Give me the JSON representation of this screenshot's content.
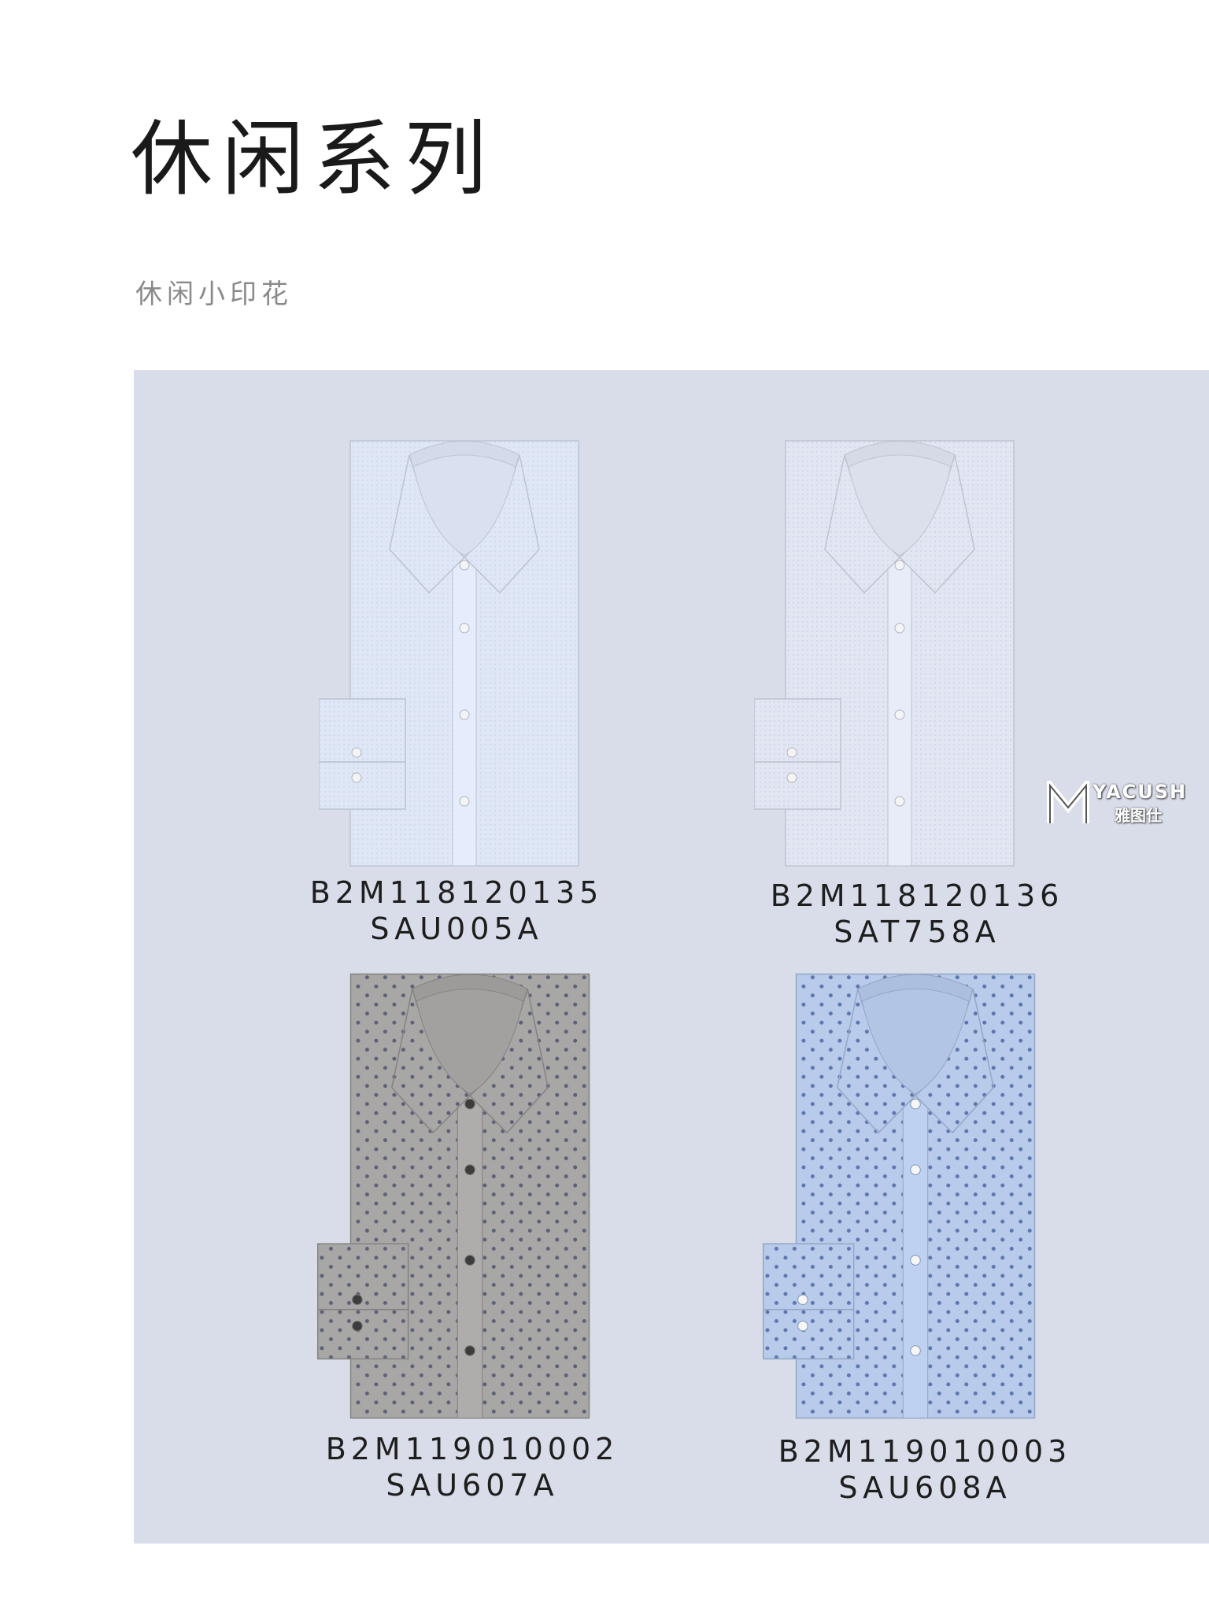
{
  "header": {
    "title": "休闲系列",
    "subtitle": "休闲小印花"
  },
  "products": [
    {
      "code": "B2M118120135",
      "fabric": "SAU005A",
      "color": "#dfe6f5",
      "pattern": "fine",
      "dot_color": "#c9d3ea",
      "button": "#f4f4f4"
    },
    {
      "code": "B2M118120136",
      "fabric": "SAT758A",
      "color": "#e2e6f3",
      "pattern": "fine",
      "dot_color": "#c8cde3",
      "button": "#f4f4f4"
    },
    {
      "code": "B2M119010002",
      "fabric": "SAU607A",
      "color": "#a9a7a6",
      "pattern": "dots",
      "dot_color": "#5c6275",
      "button": "#3c3c3c"
    },
    {
      "code": "B2M119010003",
      "fabric": "SAU608A",
      "color": "#b8cbea",
      "pattern": "dots",
      "dot_color": "#5c77ac",
      "button": "#f6f6f6"
    }
  ],
  "watermark": {
    "brand": "YACUSH",
    "name": "雅图仕"
  }
}
